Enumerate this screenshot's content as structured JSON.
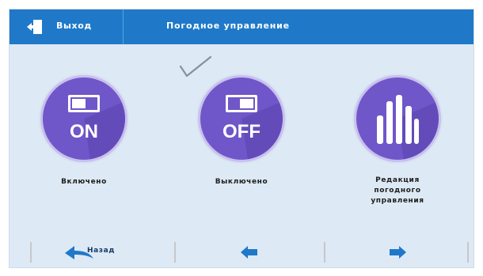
{
  "header": {
    "exit_label": "Выход",
    "title": "Погодное управление"
  },
  "tiles": [
    {
      "circle_text": "ON",
      "label": "Включено",
      "selected": true
    },
    {
      "circle_text": "OFF",
      "label": "Выключено",
      "selected": false
    },
    {
      "circle_text": "",
      "label": "Редакция\nпогодного\nуправления",
      "selected": false
    }
  ],
  "footer": {
    "back_label": "Назад"
  },
  "colors": {
    "accent": "#1f79c8",
    "circle": "#6f57c9",
    "background": "#dde9f5",
    "nav_icon": "#1f79c8"
  },
  "icons": {
    "exit": "exit-door-icon",
    "check": "checkmark-icon",
    "back": "back-arrow-icon",
    "left": "arrow-left-icon",
    "right": "arrow-right-icon",
    "toggle": "toggle-switch-icon",
    "bars": "bars-chart-icon"
  }
}
